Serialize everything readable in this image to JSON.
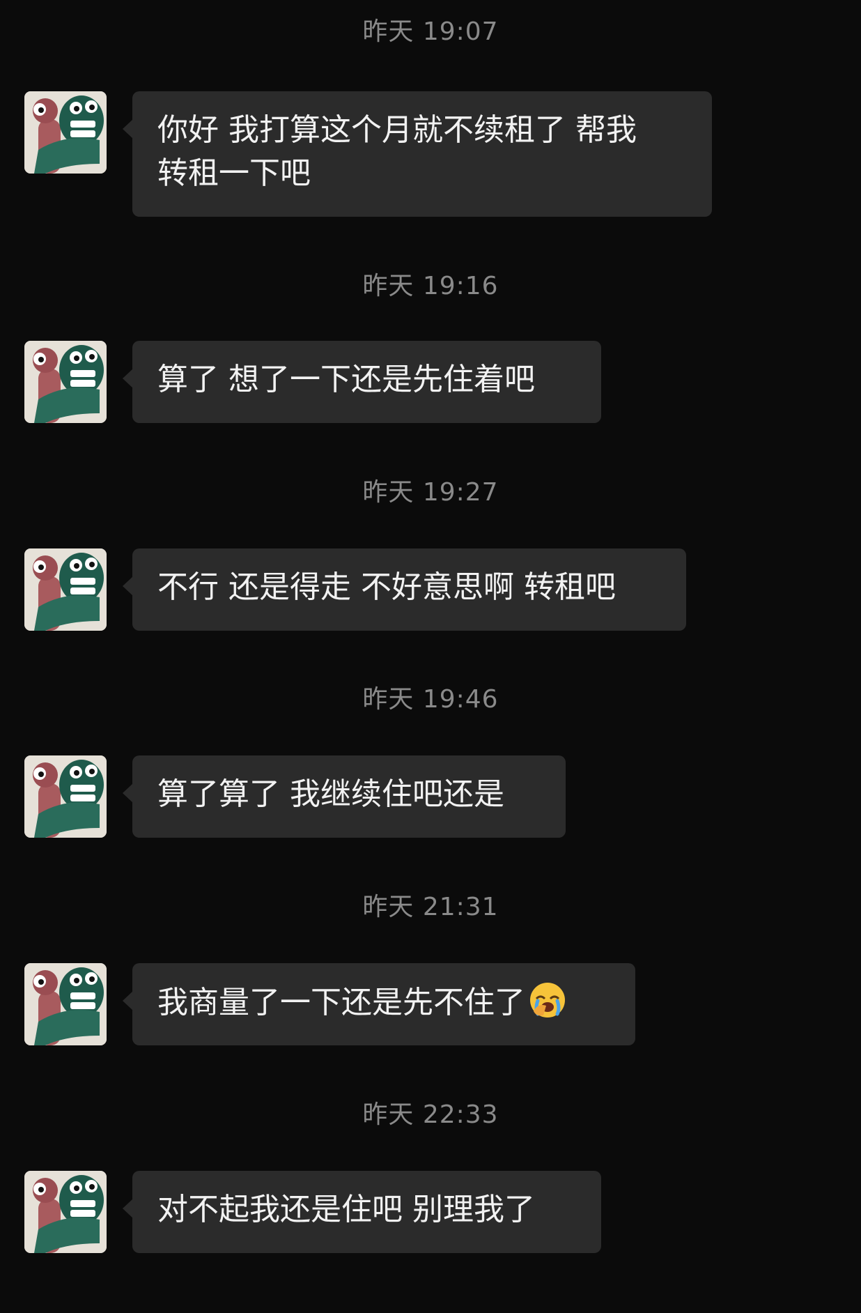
{
  "colors": {
    "background": "#0b0b0b",
    "bubble": "#2b2b2b",
    "text": "#f2f2f2",
    "timestamp": "#8a8a8a"
  },
  "messages": [
    {
      "timestamp": "昨天 19:07",
      "text": "你好 我打算这个月就不续租了 帮我\n转租一下吧",
      "emoji": ""
    },
    {
      "timestamp": "昨天 19:16",
      "text": "算了 想了一下还是先住着吧",
      "emoji": ""
    },
    {
      "timestamp": "昨天 19:27",
      "text": "不行 还是得走 不好意思啊 转租吧",
      "emoji": ""
    },
    {
      "timestamp": "昨天 19:46",
      "text": "算了算了 我继续住吧还是",
      "emoji": ""
    },
    {
      "timestamp": "昨天 21:31",
      "text": "我商量了一下还是先不住了",
      "emoji": "crying-face-palm-icon"
    },
    {
      "timestamp": "昨天 22:33",
      "text": "对不起我还是住吧 别理我了",
      "emoji": ""
    }
  ]
}
